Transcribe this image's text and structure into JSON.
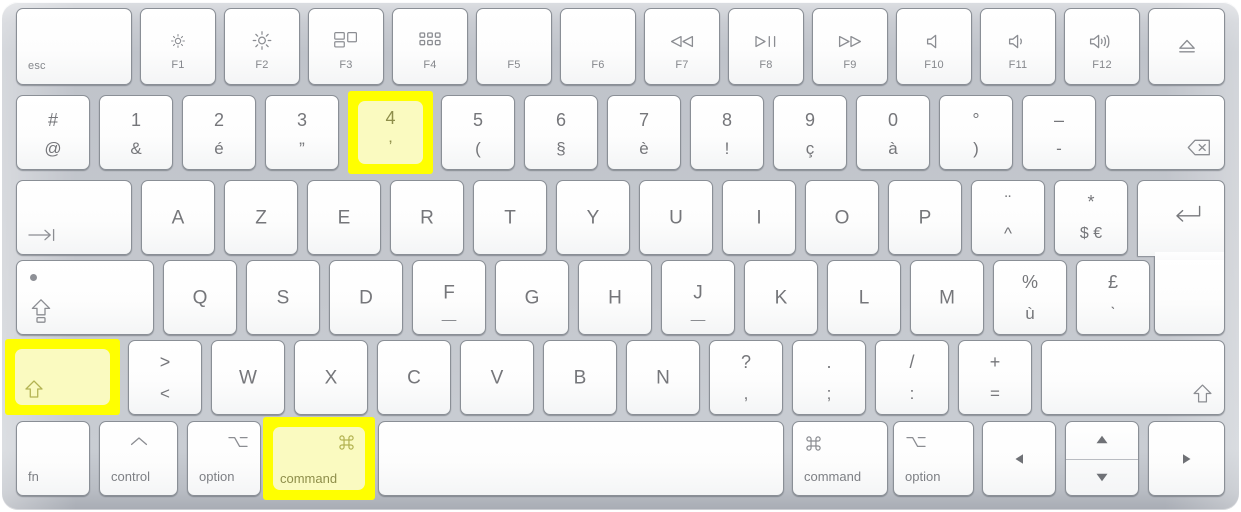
{
  "device": {
    "name": "Apple Magic Keyboard",
    "layout": "French AZERTY",
    "body_color": "#c4c7cd",
    "key_color": "#ffffff",
    "label_color": "#77787c",
    "highlight_border_color": "#ffff00",
    "highlight_face_color": "#fafac0"
  },
  "shortcut": {
    "highlighted_keys": [
      "shift-left",
      "command-left",
      "4"
    ],
    "description": "Shift + Command + 4"
  },
  "rows": {
    "function_row": [
      {
        "id": "esc",
        "label": "esc",
        "icon": "",
        "name": "esc-key"
      },
      {
        "id": "f1",
        "label": "F1",
        "icon": "brightness-down-icon",
        "name": "f1-key"
      },
      {
        "id": "f2",
        "label": "F2",
        "icon": "brightness-up-icon",
        "name": "f2-key"
      },
      {
        "id": "f3",
        "label": "F3",
        "icon": "mission-control-icon",
        "name": "f3-key"
      },
      {
        "id": "f4",
        "label": "F4",
        "icon": "launchpad-icon",
        "name": "f4-key"
      },
      {
        "id": "f5",
        "label": "F5",
        "icon": "",
        "name": "f5-key"
      },
      {
        "id": "f6",
        "label": "F6",
        "icon": "",
        "name": "f6-key"
      },
      {
        "id": "f7",
        "label": "F7",
        "icon": "rewind-icon",
        "name": "f7-key"
      },
      {
        "id": "f8",
        "label": "F8",
        "icon": "play-pause-icon",
        "name": "f8-key"
      },
      {
        "id": "f9",
        "label": "F9",
        "icon": "fast-forward-icon",
        "name": "f9-key"
      },
      {
        "id": "f10",
        "label": "F10",
        "icon": "mute-icon",
        "name": "f10-key"
      },
      {
        "id": "f11",
        "label": "F11",
        "icon": "volume-down-icon",
        "name": "f11-key"
      },
      {
        "id": "f12",
        "label": "F12",
        "icon": "volume-up-icon",
        "name": "f12-key"
      },
      {
        "id": "eject",
        "label": "",
        "icon": "eject-icon",
        "name": "eject-key"
      }
    ],
    "number_row": [
      {
        "id": "sq",
        "top": "#",
        "bottom": "@",
        "name": "hash-at-key"
      },
      {
        "id": "1",
        "top": "1",
        "bottom": "&",
        "name": "1-key"
      },
      {
        "id": "2",
        "top": "2",
        "bottom": "é",
        "name": "2-key"
      },
      {
        "id": "3",
        "top": "3",
        "bottom": "”",
        "name": "3-key"
      },
      {
        "id": "4",
        "top": "4",
        "bottom": "’",
        "name": "4-key",
        "highlight": true
      },
      {
        "id": "5",
        "top": "5",
        "bottom": "(",
        "name": "5-key"
      },
      {
        "id": "6",
        "top": "6",
        "bottom": "§",
        "name": "6-key"
      },
      {
        "id": "7",
        "top": "7",
        "bottom": "è",
        "name": "7-key"
      },
      {
        "id": "8",
        "top": "8",
        "bottom": "!",
        "name": "8-key"
      },
      {
        "id": "9",
        "top": "9",
        "bottom": "ç",
        "name": "9-key"
      },
      {
        "id": "0",
        "top": "0",
        "bottom": "à",
        "name": "0-key"
      },
      {
        "id": "deg",
        "top": "°",
        "bottom": ")",
        "name": "degree-paren-key"
      },
      {
        "id": "dash",
        "top": "–",
        "bottom": "-",
        "name": "dash-key"
      },
      {
        "id": "del",
        "top": "",
        "bottom": "",
        "icon": "delete-icon",
        "name": "delete-key"
      }
    ],
    "tab_row": [
      {
        "id": "tab",
        "label": "",
        "icon": "tab-icon",
        "name": "tab-key"
      },
      {
        "id": "a",
        "label": "A",
        "name": "a-key"
      },
      {
        "id": "z",
        "label": "Z",
        "name": "z-key"
      },
      {
        "id": "e",
        "label": "E",
        "name": "e-key"
      },
      {
        "id": "r",
        "label": "R",
        "name": "r-key"
      },
      {
        "id": "t",
        "label": "T",
        "name": "t-key"
      },
      {
        "id": "y",
        "label": "Y",
        "name": "y-key"
      },
      {
        "id": "u",
        "label": "U",
        "name": "u-key"
      },
      {
        "id": "i",
        "label": "I",
        "name": "i-key"
      },
      {
        "id": "o",
        "label": "O",
        "name": "o-key"
      },
      {
        "id": "p",
        "label": "P",
        "name": "p-key"
      },
      {
        "id": "circ",
        "top": "¨",
        "bottom": "^",
        "name": "circumflex-key"
      },
      {
        "id": "dollar",
        "top": "*",
        "bottom": "$ €",
        "name": "dollar-euro-key"
      }
    ],
    "caps_row": [
      {
        "id": "capslock",
        "label": "",
        "icon": "capslock-icon",
        "name": "capslock-key"
      },
      {
        "id": "q",
        "label": "Q",
        "name": "q-key"
      },
      {
        "id": "s",
        "label": "S",
        "name": "s-key"
      },
      {
        "id": "d",
        "label": "D",
        "name": "d-key"
      },
      {
        "id": "f",
        "label": "F",
        "name": "f-key",
        "homing": true
      },
      {
        "id": "g",
        "label": "G",
        "name": "g-key"
      },
      {
        "id": "h",
        "label": "H",
        "name": "h-key"
      },
      {
        "id": "j",
        "label": "J",
        "name": "j-key",
        "homing": true
      },
      {
        "id": "k",
        "label": "K",
        "name": "k-key"
      },
      {
        "id": "l",
        "label": "L",
        "name": "l-key"
      },
      {
        "id": "m",
        "label": "M",
        "name": "m-key"
      },
      {
        "id": "pct",
        "top": "%",
        "bottom": "ù",
        "name": "percent-u-key"
      },
      {
        "id": "pound",
        "top": "£",
        "bottom": "ˋ",
        "name": "pound-key"
      }
    ],
    "shift_row": [
      {
        "id": "lshift",
        "label": "",
        "icon": "shift-icon",
        "name": "left-shift-key",
        "highlight": true
      },
      {
        "id": "angle",
        "top": ">",
        "bottom": "<",
        "name": "angle-bracket-key"
      },
      {
        "id": "w",
        "label": "W",
        "name": "w-key"
      },
      {
        "id": "x",
        "label": "X",
        "name": "x-key"
      },
      {
        "id": "c",
        "label": "C",
        "name": "c-key"
      },
      {
        "id": "v",
        "label": "V",
        "name": "v-key"
      },
      {
        "id": "b",
        "label": "B",
        "name": "b-key"
      },
      {
        "id": "n",
        "label": "N",
        "name": "n-key"
      },
      {
        "id": "comma",
        "top": "?",
        "bottom": ",",
        "name": "question-comma-key"
      },
      {
        "id": "semi",
        "top": ".",
        "bottom": ";",
        "name": "period-semicolon-key"
      },
      {
        "id": "colon",
        "top": "/",
        "bottom": ":",
        "name": "slash-colon-key"
      },
      {
        "id": "equal",
        "top": "+",
        "bottom": "=",
        "name": "plus-equals-key"
      },
      {
        "id": "rshift",
        "label": "",
        "icon": "shift-icon",
        "name": "right-shift-key"
      }
    ],
    "bottom_row": [
      {
        "id": "fn",
        "label": "fn",
        "name": "fn-key"
      },
      {
        "id": "control",
        "label": "control",
        "icon": "control-icon",
        "name": "control-key"
      },
      {
        "id": "loption",
        "label": "option",
        "icon": "option-icon",
        "name": "left-option-key"
      },
      {
        "id": "lcommand",
        "label": "command",
        "icon": "command-icon",
        "name": "left-command-key",
        "highlight": true
      },
      {
        "id": "space",
        "label": "",
        "name": "space-key"
      },
      {
        "id": "rcommand",
        "label": "command",
        "icon": "command-icon",
        "name": "right-command-key"
      },
      {
        "id": "roption",
        "label": "option",
        "icon": "option-icon",
        "name": "right-option-key"
      },
      {
        "id": "left",
        "label": "",
        "icon": "arrow-left-icon",
        "name": "left-arrow-key"
      },
      {
        "id": "updown",
        "label": "",
        "icon": "arrow-up-down-icon",
        "name": "up-down-arrow-key"
      },
      {
        "id": "right",
        "label": "",
        "icon": "arrow-right-icon",
        "name": "right-arrow-key"
      }
    ]
  }
}
